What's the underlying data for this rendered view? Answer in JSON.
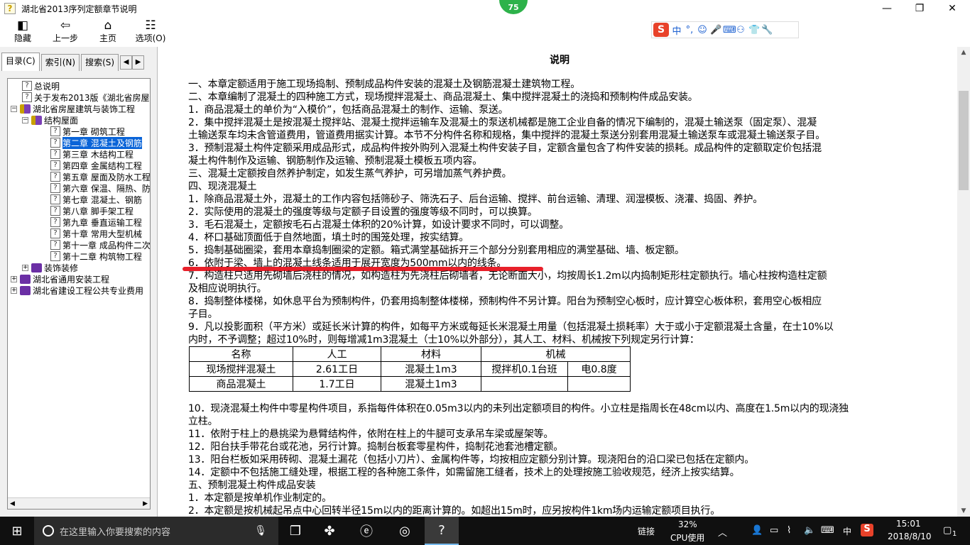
{
  "window": {
    "title": "湖北省2013序列定额章节说明",
    "badge": "75",
    "controls": {
      "minimize": "—",
      "restore": "❐",
      "close": "✕"
    }
  },
  "toolbar": [
    {
      "icon": "◧",
      "label": "隐藏"
    },
    {
      "icon": "⇦",
      "label": "上一步"
    },
    {
      "icon": "⌂",
      "label": "主页"
    },
    {
      "icon": "☷",
      "label": "选项(O)"
    }
  ],
  "ime": {
    "logo": "S",
    "items": [
      "中",
      "°,",
      "☺",
      "🎤",
      "⌨",
      "⚇",
      "👕",
      "🔧"
    ]
  },
  "tabs": [
    {
      "label": "目录(C)",
      "active": true
    },
    {
      "label": "索引(N)",
      "active": false
    },
    {
      "label": "搜索(S)",
      "active": false
    }
  ],
  "tree": [
    {
      "level": 2,
      "icon": "q",
      "text": "总说明"
    },
    {
      "level": 2,
      "icon": "q",
      "text": "关于发布2013版《湖北省房屋"
    },
    {
      "level": 0,
      "icon": "book",
      "expander": "−",
      "text": "湖北省房屋建筑与装饰工程"
    },
    {
      "level": 1,
      "icon": "book",
      "expander": "−",
      "text": "结构屋面"
    },
    {
      "level": 3,
      "icon": "q",
      "text": "第一章 砌筑工程"
    },
    {
      "level": 3,
      "icon": "q",
      "text": "第二章 混凝土及钢筋",
      "selected": true
    },
    {
      "level": 3,
      "icon": "q",
      "text": "第三章 木结构工程"
    },
    {
      "level": 3,
      "icon": "q",
      "text": "第四章 金属结构工程"
    },
    {
      "level": 3,
      "icon": "q",
      "text": "第五章 屋面及防水工程"
    },
    {
      "level": 3,
      "icon": "q",
      "text": "第六章 保温、隔热、防"
    },
    {
      "level": 3,
      "icon": "q",
      "text": "第七章 混凝土、钢筋"
    },
    {
      "level": 3,
      "icon": "q",
      "text": "第八章 脚手架工程"
    },
    {
      "level": 3,
      "icon": "q",
      "text": "第九章 垂直运输工程"
    },
    {
      "level": 3,
      "icon": "q",
      "text": "第十章 常用大型机械"
    },
    {
      "level": 3,
      "icon": "q",
      "text": "第十一章 成品构件二次"
    },
    {
      "level": 3,
      "icon": "q",
      "text": "第十二章 构筑物工程"
    },
    {
      "level": 1,
      "icon": "bookp",
      "expander": "+",
      "text": "装饰装修"
    },
    {
      "level": 0,
      "icon": "bookp",
      "expander": "+",
      "text": "湖北省通用安装工程"
    },
    {
      "level": 0,
      "icon": "bookp",
      "expander": "+",
      "text": "湖北省建设工程公共专业费用"
    }
  ],
  "doc": {
    "title": "说明",
    "lines": [
      "一、本章定额适用于施工现场捣制、预制成品构件安装的混凝土及钢筋混凝土建筑物工程。",
      "二、本章编制了混凝土的四种施工方式，现场搅拌混凝土、商品混凝土、集中搅拌混凝土的浇捣和预制构件成品安装。",
      "1．商品混凝土的单价为“入模价”，包括商品混凝土的制作、运输、泵送。",
      "2．集中搅拌混凝土是按混凝土搅拌站、混凝土搅拌运输车及混凝土的泵送机械都是施工企业自备的情况下编制的，混凝土输送泵（固定泵）、混凝",
      "土输送泵车均未含管道费用，管道费用据实计算。本节不分构件名称和规格，集中搅拌的混凝土泵送分别套用混凝土输送泵车或混凝土输送泵子目。",
      "3．预制混凝土构件定额采用成品形式，成品构件按外购列入混凝土构件安装子目，定额含量包含了构件安装的损耗。成品构件的定额取定价包括混",
      "凝土构件制作及运输、钢筋制作及运输、预制混凝土模板五项内容。",
      "三、混凝土定额按自然养护制定，如发生蒸气养护，可另增加蒸气养护费。",
      "四、现浇混凝土",
      "1．除商品混凝土外，混凝土的工作内容包括筛砂子、筛洗石子、后台运输、搅拌、前台运输、清理、润湿模板、浇灌、捣固、养护。",
      "2．实际使用的混凝土的强度等级与定额子目设置的强度等级不同时，可以换算。",
      "3．毛石混凝土，定额按毛石占混凝土体积的20%计算，如设计要求不同时，可以调整。",
      "4．杯口基础顶面低于自然地面，填土时的围笼处理，按实结算。",
      "5．捣制基础圈梁，套用本章捣制圈梁的定额。箱式满堂基础拆开三个部分分别套用相应的满堂基础、墙、板定额。",
      "6．依附于梁、墙上的混凝土线条适用于展开宽度为500mm以内的线条。",
      "7．构造柱只适用先砌墙后浇柱的情况，如构造柱为先浇柱后砌墙者，无论断面大小，均按周长1.2m以内捣制矩形柱定额执行。墙心柱按构造柱定额",
      "及相应说明执行。",
      "8．捣制整体楼梯，如休息平台为预制构件，仍套用捣制整体楼梯，预制构件不另计算。阳台为预制空心板时，应计算空心板体积，套用空心板相应",
      "子目。",
      "9．凡以投影面积（平方米）或延长米计算的构件，如每平方米或每延长米混凝土用量（包括混凝土损耗率）大于或小于定额混凝土含量，在士10%以",
      "内时，不予调整；超过10%时，则每增减1m3混凝土（士10%以外部分），其人工、材料、机械按下列规定另行计算："
    ],
    "table": {
      "header": [
        "名称",
        "人工",
        "材料",
        "机械",
        ""
      ],
      "rows": [
        [
          "现场搅拌混凝土",
          "2.61工日",
          "混凝土1m3",
          "搅拌机0.1台班",
          "电0.8度"
        ],
        [
          "商品混凝土",
          "1.7工日",
          "混凝土1m3",
          "",
          ""
        ]
      ]
    },
    "lines2": [
      "10．现浇混凝土构件中零星构件项目，系指每件体积在0.05m3以内的未列出定额项目的构件。小立柱是指周长在48cm以内、高度在1.5m以内的现浇独",
      "立柱。",
      "11．依附于柱上的悬挑梁为悬臂结构件，依附在柱上的牛腿可支承吊车梁或屋架等。",
      "12．阳台扶手带花台或花池，另行计算。捣制台板套零星构件，捣制花池套池槽定额。",
      "13．阳台栏板如采用砖砌、混凝土漏花（包括小刀片）、金属构件等，均按相应定额分别计算。现浇阳台的沿口梁已包括在定额内。",
      "14．定额中不包括施工缝处理，根据工程的各种施工条件，如需留施工缝者，技术上的处理按施工验收规范，经济上按实结算。",
      "五、预制混凝土构件成品安装",
      "1．本定额是按单机作业制定的。",
      "2．本定额是按机械起吊点中心回转半径15m以内的距离计算的。如超出15m时，应另按构件1km场内运输定额项目执行。"
    ]
  },
  "taskbar": {
    "search_placeholder": "在这里输入你要搜索的内容",
    "tray": {
      "link": "链接",
      "cpu_percent": "32%",
      "cpu_label": "CPU使用",
      "lang": "中",
      "time": "15:01",
      "date": "2018/8/10",
      "notif_count": "1"
    }
  }
}
